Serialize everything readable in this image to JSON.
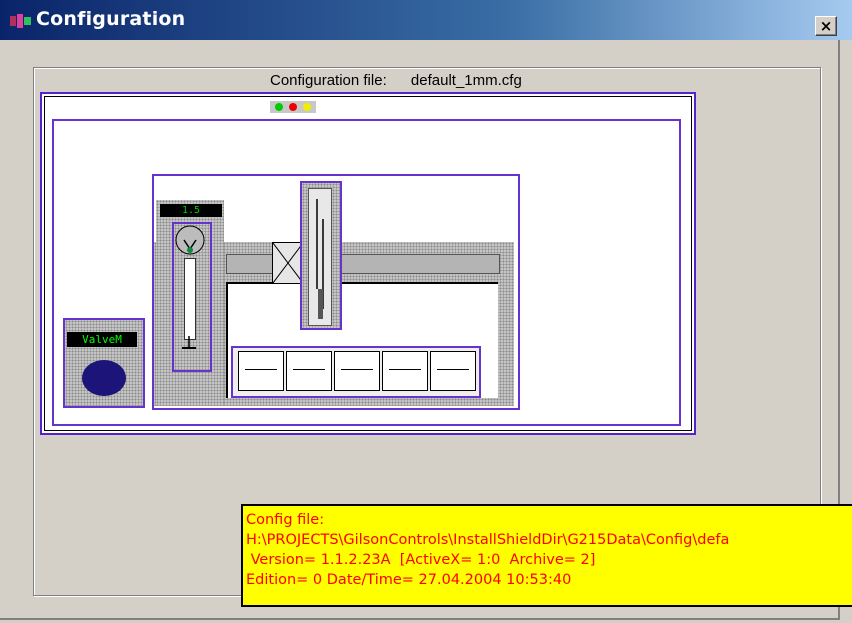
{
  "window": {
    "title": "Configuration",
    "close_label": "×",
    "icon": "app-icon"
  },
  "config_line": {
    "label": "Configuration file:",
    "filename": "default_1mm.cfg"
  },
  "diagram": {
    "status_lights": [
      "#00cc00",
      "#ee0000",
      "#eeee00"
    ],
    "pump_display": "1.5",
    "valve_display": "ValveM",
    "rack_slots": 5,
    "accent_color": "#6633cc"
  },
  "tooltip": {
    "line1": "Config file:",
    "line2": "H:\\PROJECTS\\GilsonControls\\InstallShieldDir\\G215Data\\Config\\defa",
    "line3": " Version= 1.1.2.23A  [ActiveX= 1:0  Archive= 2]",
    "line4": "Edition= 0  Date/Time= 27.04.2004 10:53:40"
  }
}
